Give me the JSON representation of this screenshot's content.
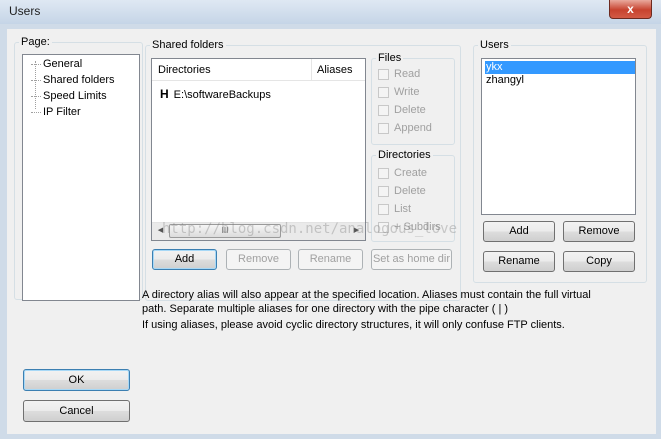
{
  "window": {
    "title": "Users",
    "close_glyph": "x"
  },
  "page_panel": {
    "legend": "Page:",
    "items": [
      "General",
      "Shared folders",
      "Speed Limits",
      "IP Filter"
    ]
  },
  "shared_folders": {
    "legend": "Shared folders",
    "columns": [
      "Directories",
      "Aliases"
    ],
    "rows": [
      {
        "marker": "H",
        "directory": "E:\\softwareBackups",
        "aliases": ""
      }
    ],
    "scroll_thumb_glyph": "III",
    "buttons": {
      "add": "Add",
      "remove": "Remove",
      "rename": "Rename",
      "set_home": "Set as home dir"
    }
  },
  "files_group": {
    "legend": "Files",
    "options": [
      "Read",
      "Write",
      "Delete",
      "Append"
    ]
  },
  "directories_group": {
    "legend": "Directories",
    "options": [
      "Create",
      "Delete",
      "List",
      "+ Subdirs"
    ]
  },
  "users_panel": {
    "legend": "Users",
    "items": [
      "ykx",
      "zhangyl"
    ],
    "selected_index": 0,
    "buttons": {
      "add": "Add",
      "remove": "Remove",
      "rename": "Rename",
      "copy": "Copy"
    }
  },
  "notes": {
    "line1": "A directory alias will also appear at the specified location. Aliases must contain the full virtual",
    "line2": "path. Separate multiple aliases for one directory with the pipe character ( | )",
    "line3": "If using aliases, please avoid cyclic directory structures, it will only confuse FTP clients."
  },
  "dialog_buttons": {
    "ok": "OK",
    "cancel": "Cancel"
  },
  "watermark": "http://blog.csdn.net/analogous_love",
  "colors": {
    "selection": "#3399ff",
    "close_button": "#c7432f"
  }
}
